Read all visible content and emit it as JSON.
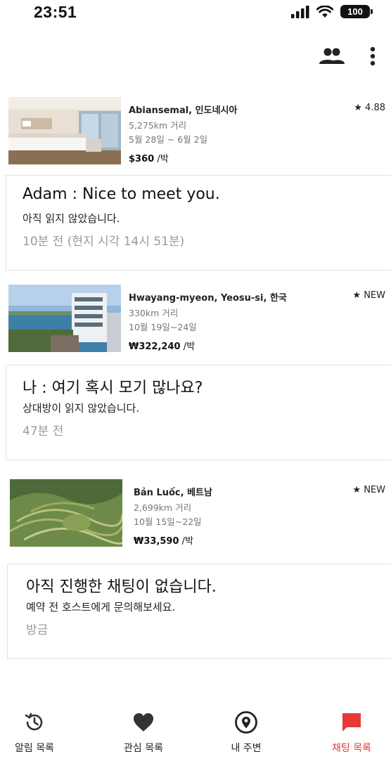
{
  "status_bar": {
    "time": "23:51",
    "battery": "100"
  },
  "colors": {
    "accent": "#e53935",
    "muted": "#9a9a9a"
  },
  "header": {
    "icons": [
      "people-icon",
      "more-vert-icon"
    ]
  },
  "conversations": [
    {
      "listing": {
        "place": "Abiansemal, 인도네시아",
        "distance": "5,275km 거리",
        "dates": "5월 28일 ~ 6월 2일",
        "price": "$360",
        "price_unit": " /박",
        "rating": "★ 4.88"
      },
      "chat": {
        "message": "Adam : Nice to meet you.",
        "status": "아직 읽지 않았습니다.",
        "time": "10분 전 (현지 시각 14시 51분)"
      }
    },
    {
      "listing": {
        "place": "Hwayang-myeon, Yeosu-si, 한국",
        "distance": "330km 거리",
        "dates": "10월 19일~24일",
        "price": "₩322,240",
        "price_unit": " /박",
        "rating": "★ NEW"
      },
      "chat": {
        "message": "나 : 여기 혹시 모기 많나요?",
        "status": "상대방이 읽지 않았습니다.",
        "time": "47분 전"
      }
    },
    {
      "listing": {
        "place": "Bản Luốc, 베트남",
        "distance": "2,699km 거리",
        "dates": "10월 15일~22일",
        "price": "₩33,590",
        "price_unit": " /박",
        "rating": "★ NEW"
      },
      "chat": {
        "message": "아직 진행한 채팅이 없습니다.",
        "status": "예약 전 호스트에게 문의해보세요.",
        "time": "방금"
      }
    }
  ],
  "tabs": [
    {
      "label": "알림 목록",
      "icon": "history-icon",
      "active": false
    },
    {
      "label": "관심 목록",
      "icon": "heart-icon",
      "active": false
    },
    {
      "label": "내 주변",
      "icon": "location-pin-icon",
      "active": false
    },
    {
      "label": "채팅 목록",
      "icon": "chat-bubble-icon",
      "active": true
    }
  ]
}
